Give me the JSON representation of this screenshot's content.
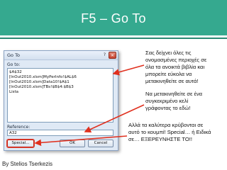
{
  "slide": {
    "title": "F5 – Go To",
    "credit": "By Stelios Tserkezis",
    "accent_color": "#35a98f",
    "arrow_color": "#e0301e"
  },
  "dialog": {
    "title": "Go To",
    "help_icon": "question-mark-icon",
    "close_icon": "close-x-icon",
    "goto_label": "Go to:",
    "goto_items": [
      "$A$32",
      "[InOut2010.xlsm]MyPerInfo!$AL$6",
      "[InOut2010.xlsm]Data10!$A$1",
      "[InOut2010.xlsm]TBs!$B$4:$B$3",
      "Lista"
    ],
    "reference_label": "Reference:",
    "reference_value": "A32",
    "special_button": "Special...",
    "ok_button": "OK",
    "cancel_button": "Cancel"
  },
  "callouts": {
    "first": [
      "Σας δείχνει όλες τις",
      "ονομασμένες περιοχές σε",
      "όλα τα ανοικτά βιβλία και",
      "μπορείτε εύκολα να",
      "μετακινηθείτε σε αυτά!"
    ],
    "second": [
      "Να μετακινηθείτε σε ένα",
      "συγκεκριμένο κελί",
      "γράφοντας το εδώ!"
    ],
    "third": [
      "Αλλά τα καλύτερα κρύβονται σε",
      "αυτό το κουμπί! Special… ή Ειδικά",
      "σε… ΕΞΕΡΕΥΝΗΣΤΕ ΤΟ!!"
    ]
  }
}
